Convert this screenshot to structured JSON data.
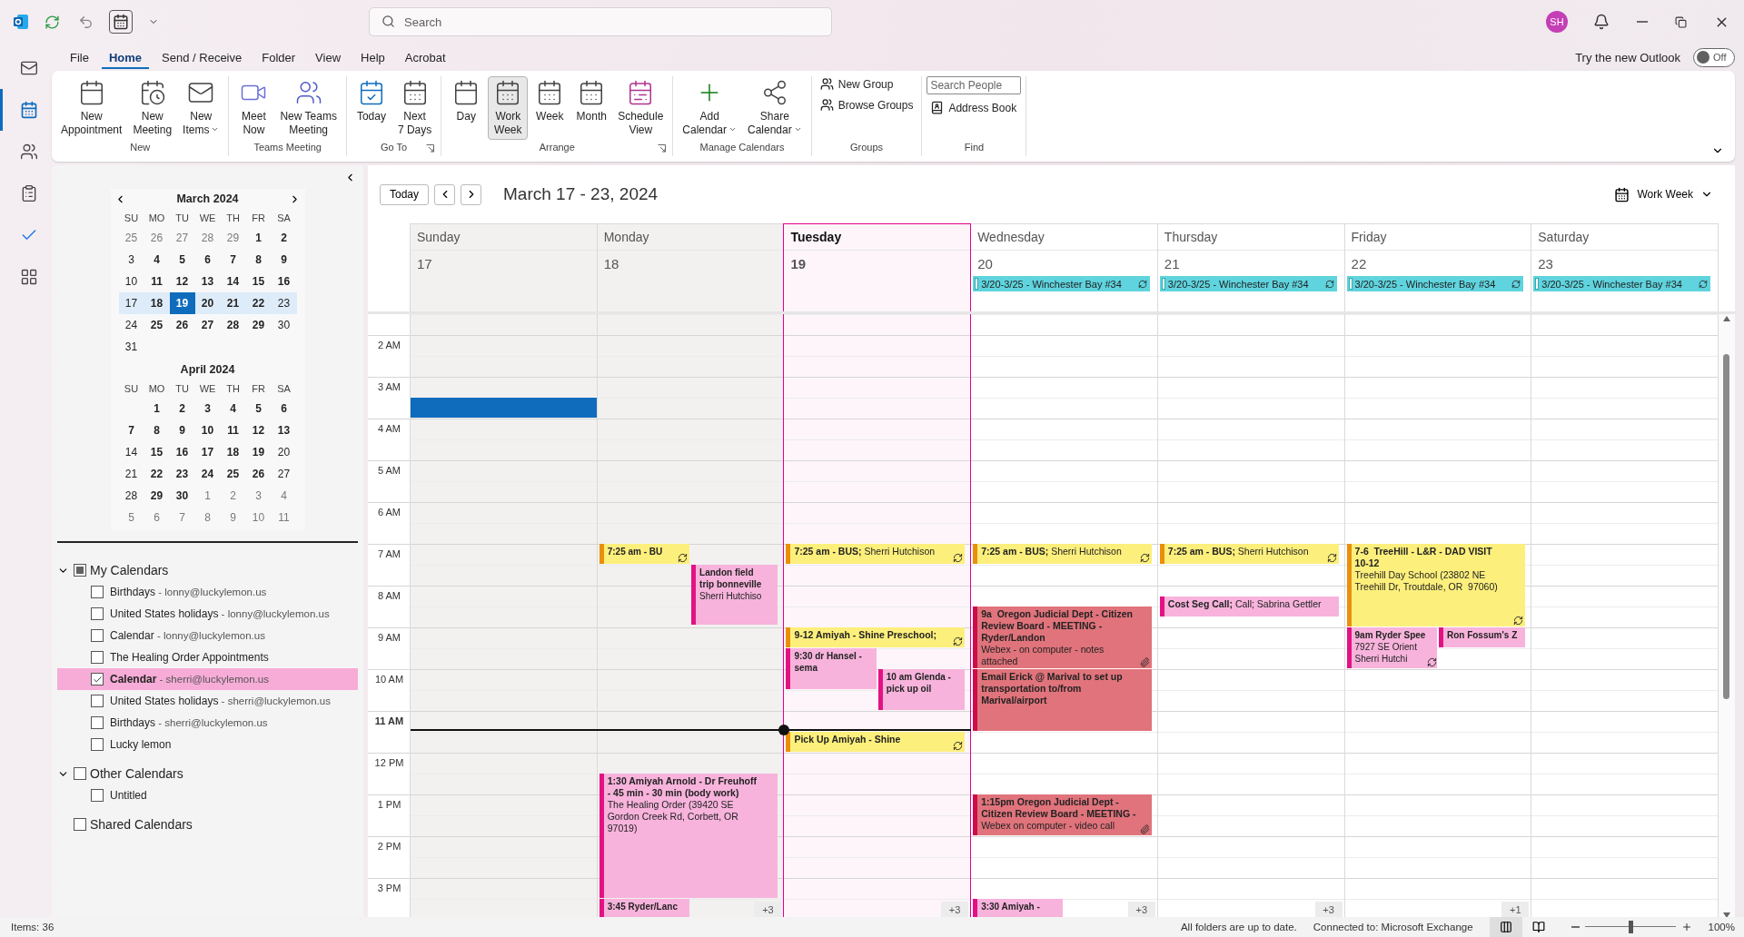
{
  "title_bar": {
    "search_placeholder": "Search",
    "avatar": "SH"
  },
  "nav_rail": [
    {
      "selected": false
    },
    {
      "selected": true
    },
    {
      "selected": false
    },
    {
      "selected": false
    },
    {
      "selected": false
    },
    {
      "selected": false
    }
  ],
  "menu_tabs": [
    {
      "label": "File",
      "selected": false
    },
    {
      "label": "Home",
      "selected": true
    },
    {
      "label": "Send / Receive",
      "selected": false
    },
    {
      "label": "Folder",
      "selected": false
    },
    {
      "label": "View",
      "selected": false
    },
    {
      "label": "Help",
      "selected": false
    },
    {
      "label": "Acrobat",
      "selected": false
    }
  ],
  "new_outlook": {
    "label": "Try the new Outlook",
    "toggle": "Off",
    "on": false
  },
  "ribbon": [
    {
      "label": "New",
      "kind": "large",
      "buttons": [
        {
          "label": "New\nAppointment",
          "dropdown": false
        },
        {
          "label": "New\nMeeting",
          "dropdown": false
        },
        {
          "label": "New\nItems",
          "dropdown": true
        }
      ]
    },
    {
      "label": "Teams Meeting",
      "kind": "large",
      "buttons": [
        {
          "label": "Meet\nNow",
          "dropdown": false
        },
        {
          "label": "New Teams\nMeeting",
          "dropdown": false
        }
      ]
    },
    {
      "label": "Go To",
      "kind": "large",
      "launcher": true,
      "buttons": [
        {
          "label": "Today",
          "dropdown": false
        },
        {
          "label": "Next\n7 Days",
          "dropdown": false
        }
      ]
    },
    {
      "label": "Arrange",
      "kind": "large",
      "launcher": true,
      "buttons": [
        {
          "label": "Day",
          "dropdown": false,
          "selected": false
        },
        {
          "label": "Work\nWeek",
          "dropdown": false,
          "selected": true
        },
        {
          "label": "Week",
          "dropdown": false,
          "selected": false
        },
        {
          "label": "Month",
          "dropdown": false,
          "selected": false
        },
        {
          "label": "Schedule\nView",
          "dropdown": false,
          "selected": false
        }
      ]
    },
    {
      "label": "Manage Calendars",
      "kind": "large",
      "buttons": [
        {
          "label": "Add\nCalendar",
          "dropdown": true
        },
        {
          "label": "Share\nCalendar",
          "dropdown": true
        }
      ]
    },
    {
      "label": "Groups",
      "kind": "small",
      "buttons": [
        {
          "label": "New Group"
        },
        {
          "label": "Browse Groups"
        }
      ]
    },
    {
      "label": "Find",
      "kind": "find",
      "search_placeholder": "Search People",
      "buttons": [
        {
          "label": "Address Book"
        }
      ]
    }
  ],
  "mini_calendars": [
    {
      "title": "March 2024",
      "weekdays": [
        "SU",
        "MO",
        "TU",
        "WE",
        "TH",
        "FR",
        "SA"
      ],
      "weeks": [
        {
          "highlighted": false,
          "days": [
            {
              "text": "25",
              "bold": false,
              "muted": true,
              "selected": false
            },
            {
              "text": "26",
              "bold": false,
              "muted": true,
              "selected": false
            },
            {
              "text": "27",
              "bold": false,
              "muted": true,
              "selected": false
            },
            {
              "text": "28",
              "bold": false,
              "muted": true,
              "selected": false
            },
            {
              "text": "29",
              "bold": false,
              "muted": true,
              "selected": false
            },
            {
              "text": "1",
              "bold": true,
              "muted": false,
              "selected": false
            },
            {
              "text": "2",
              "bold": true,
              "muted": false,
              "selected": false
            }
          ]
        },
        {
          "highlighted": false,
          "days": [
            {
              "text": "3",
              "bold": false,
              "muted": false,
              "selected": false
            },
            {
              "text": "4",
              "bold": true,
              "muted": false,
              "selected": false
            },
            {
              "text": "5",
              "bold": true,
              "muted": false,
              "selected": false
            },
            {
              "text": "6",
              "bold": true,
              "muted": false,
              "selected": false
            },
            {
              "text": "7",
              "bold": true,
              "muted": false,
              "selected": false
            },
            {
              "text": "8",
              "bold": true,
              "muted": false,
              "selected": false
            },
            {
              "text": "9",
              "bold": true,
              "muted": false,
              "selected": false
            }
          ]
        },
        {
          "highlighted": false,
          "days": [
            {
              "text": "10",
              "bold": false,
              "muted": false,
              "selected": false
            },
            {
              "text": "11",
              "bold": true,
              "muted": false,
              "selected": false
            },
            {
              "text": "12",
              "bold": true,
              "muted": false,
              "selected": false
            },
            {
              "text": "13",
              "bold": true,
              "muted": false,
              "selected": false
            },
            {
              "text": "14",
              "bold": true,
              "muted": false,
              "selected": false
            },
            {
              "text": "15",
              "bold": true,
              "muted": false,
              "selected": false
            },
            {
              "text": "16",
              "bold": true,
              "muted": false,
              "selected": false
            }
          ]
        },
        {
          "highlighted": true,
          "days": [
            {
              "text": "17",
              "bold": false,
              "muted": false,
              "selected": false
            },
            {
              "text": "18",
              "bold": true,
              "muted": false,
              "selected": false
            },
            {
              "text": "19",
              "bold": true,
              "muted": false,
              "selected": true
            },
            {
              "text": "20",
              "bold": true,
              "muted": false,
              "selected": false
            },
            {
              "text": "21",
              "bold": true,
              "muted": false,
              "selected": false
            },
            {
              "text": "22",
              "bold": true,
              "muted": false,
              "selected": false
            },
            {
              "text": "23",
              "bold": false,
              "muted": false,
              "selected": false
            }
          ]
        },
        {
          "highlighted": false,
          "days": [
            {
              "text": "24",
              "bold": false,
              "muted": false,
              "selected": false
            },
            {
              "text": "25",
              "bold": true,
              "muted": false,
              "selected": false
            },
            {
              "text": "26",
              "bold": true,
              "muted": false,
              "selected": false
            },
            {
              "text": "27",
              "bold": true,
              "muted": false,
              "selected": false
            },
            {
              "text": "28",
              "bold": true,
              "muted": false,
              "selected": false
            },
            {
              "text": "29",
              "bold": true,
              "muted": false,
              "selected": false
            },
            {
              "text": "30",
              "bold": false,
              "muted": false,
              "selected": false
            }
          ]
        },
        {
          "highlighted": false,
          "days": [
            {
              "text": "31",
              "bold": false,
              "muted": false,
              "selected": false
            }
          ]
        }
      ]
    },
    {
      "title": "April 2024",
      "weekdays": [
        "SU",
        "MO",
        "TU",
        "WE",
        "TH",
        "FR",
        "SA"
      ],
      "weeks": [
        {
          "highlighted": false,
          "days": [
            {
              "text": "1",
              "bold": true,
              "muted": false,
              "selected": false
            },
            {
              "text": "2",
              "bold": true,
              "muted": false,
              "selected": false
            },
            {
              "text": "3",
              "bold": true,
              "muted": false,
              "selected": false
            },
            {
              "text": "4",
              "bold": true,
              "muted": false,
              "selected": false
            },
            {
              "text": "5",
              "bold": true,
              "muted": false,
              "selected": false
            },
            {
              "text": "6",
              "bold": true,
              "muted": false,
              "selected": false
            }
          ]
        },
        {
          "highlighted": false,
          "days": [
            {
              "text": "7",
              "bold": true,
              "muted": false,
              "selected": false
            },
            {
              "text": "8",
              "bold": true,
              "muted": false,
              "selected": false
            },
            {
              "text": "9",
              "bold": true,
              "muted": false,
              "selected": false
            },
            {
              "text": "10",
              "bold": true,
              "muted": false,
              "selected": false
            },
            {
              "text": "11",
              "bold": true,
              "muted": false,
              "selected": false
            },
            {
              "text": "12",
              "bold": true,
              "muted": false,
              "selected": false
            },
            {
              "text": "13",
              "bold": true,
              "muted": false,
              "selected": false
            }
          ]
        },
        {
          "highlighted": false,
          "days": [
            {
              "text": "14",
              "bold": false,
              "muted": false,
              "selected": false
            },
            {
              "text": "15",
              "bold": true,
              "muted": false,
              "selected": false
            },
            {
              "text": "16",
              "bold": true,
              "muted": false,
              "selected": false
            },
            {
              "text": "17",
              "bold": true,
              "muted": false,
              "selected": false
            },
            {
              "text": "18",
              "bold": true,
              "muted": false,
              "selected": false
            },
            {
              "text": "19",
              "bold": true,
              "muted": false,
              "selected": false
            },
            {
              "text": "20",
              "bold": false,
              "muted": false,
              "selected": false
            }
          ]
        },
        {
          "highlighted": false,
          "days": [
            {
              "text": "21",
              "bold": false,
              "muted": false,
              "selected": false
            },
            {
              "text": "22",
              "bold": true,
              "muted": false,
              "selected": false
            },
            {
              "text": "23",
              "bold": true,
              "muted": false,
              "selected": false
            },
            {
              "text": "24",
              "bold": true,
              "muted": false,
              "selected": false
            },
            {
              "text": "25",
              "bold": true,
              "muted": false,
              "selected": false
            },
            {
              "text": "26",
              "bold": true,
              "muted": false,
              "selected": false
            },
            {
              "text": "27",
              "bold": false,
              "muted": false,
              "selected": false
            }
          ]
        },
        {
          "highlighted": false,
          "days": [
            {
              "text": "28",
              "bold": false,
              "muted": false,
              "selected": false
            },
            {
              "text": "29",
              "bold": true,
              "muted": false,
              "selected": false
            },
            {
              "text": "30",
              "bold": true,
              "muted": false,
              "selected": false
            },
            {
              "text": "1",
              "bold": false,
              "muted": true,
              "selected": false
            },
            {
              "text": "2",
              "bold": false,
              "muted": true,
              "selected": false
            },
            {
              "text": "3",
              "bold": false,
              "muted": true,
              "selected": false
            },
            {
              "text": "4",
              "bold": false,
              "muted": true,
              "selected": false
            }
          ]
        },
        {
          "highlighted": false,
          "days": [
            {
              "text": "5",
              "bold": false,
              "muted": true,
              "selected": false
            },
            {
              "text": "6",
              "bold": false,
              "muted": true,
              "selected": false
            },
            {
              "text": "7",
              "bold": false,
              "muted": true,
              "selected": false
            },
            {
              "text": "8",
              "bold": false,
              "muted": true,
              "selected": false
            },
            {
              "text": "9",
              "bold": false,
              "muted": true,
              "selected": false
            },
            {
              "text": "10",
              "bold": false,
              "muted": true,
              "selected": false
            },
            {
              "text": "11",
              "bold": false,
              "muted": true,
              "selected": false
            }
          ]
        }
      ]
    }
  ],
  "calendar_groups": [
    {
      "label": "My Calendars",
      "expanded": true,
      "checked": false,
      "partial": true,
      "items": [
        {
          "name": "Birthdays",
          "account": "- lonny@luckylemon.us",
          "checked": false,
          "selected": false
        },
        {
          "name": "United States holidays",
          "account": "- lonny@luckylemon.us",
          "checked": false,
          "selected": false
        },
        {
          "name": "Calendar",
          "account": "- lonny@luckylemon.us",
          "checked": false,
          "selected": false
        },
        {
          "name": "The Healing Order Appointments",
          "checked": false,
          "selected": false
        },
        {
          "name": "Calendar",
          "account": "- sherri@luckylemon.us",
          "checked": true,
          "selected": true
        },
        {
          "name": "United States holidays",
          "account": "- sherri@luckylemon.us",
          "checked": false,
          "selected": false
        },
        {
          "name": "Birthdays",
          "account": "- sherri@luckylemon.us",
          "checked": false,
          "selected": false
        },
        {
          "name": "Lucky lemon",
          "checked": false,
          "selected": false
        }
      ]
    },
    {
      "label": "Other Calendars",
      "expanded": true,
      "checked": false,
      "partial": false,
      "items": [
        {
          "name": "Untitled",
          "checked": false,
          "selected": false
        }
      ]
    },
    {
      "label": "Shared Calendars",
      "checked": false,
      "partial": false
    }
  ],
  "calendar": {
    "today_button": "Today",
    "title": "March 17 - 23, 2024",
    "view": "Work Week",
    "hours": [
      {
        "label": "2 AM",
        "current": false
      },
      {
        "label": "3 AM",
        "current": false
      },
      {
        "label": "4 AM",
        "current": false
      },
      {
        "label": "5 AM",
        "current": false
      },
      {
        "label": "6 AM",
        "current": false
      },
      {
        "label": "7 AM",
        "current": false
      },
      {
        "label": "8 AM",
        "current": false
      },
      {
        "label": "9 AM",
        "current": false
      },
      {
        "label": "10 AM",
        "current": false
      },
      {
        "label": "11 AM",
        "current": true
      },
      {
        "label": "12 PM",
        "current": false
      },
      {
        "label": "1 PM",
        "current": false
      },
      {
        "label": "2 PM",
        "current": false
      },
      {
        "label": "3 PM",
        "current": false
      }
    ],
    "days": [
      {
        "name": "Sunday",
        "date": "17",
        "selected": false,
        "past": true,
        "events": [
          {
            "kind": "selection"
          }
        ]
      },
      {
        "name": "Monday",
        "date": "18",
        "selected": false,
        "past": true,
        "more": "+3",
        "events": [
          {
            "kind": "event",
            "color": "#fdef7c",
            "text": "**7:25 am - BU**",
            "recurring": true
          },
          {
            "kind": "event",
            "color": "#f7b3dc",
            "text": "**Landon field\ntrip bonneville**\nSherri Hutchiso"
          },
          {
            "kind": "event",
            "color": "#f7b3dc",
            "text": "**1:30 Amiyah Arnold - Dr Freuhoff\n- 45 min - 30 min (body work)**\nThe Healing Order (39420 SE\nGordon Creek Rd, Corbett, OR\n97019)"
          },
          {
            "kind": "event",
            "color": "#f7b3dc",
            "text": "**3:45 Ryder/Lanc**"
          }
        ]
      },
      {
        "name": "Tuesday",
        "date": "19",
        "selected": true,
        "past": false,
        "more": "+3",
        "events": [
          {
            "kind": "event",
            "color": "#fdef7c",
            "text": "**7:25 am - BUS;** Sherri Hutchison",
            "recurring": true
          },
          {
            "kind": "event",
            "color": "#fdef7c",
            "text": "**9-12 Amiyah - Shine Preschool;**",
            "recurring": true
          },
          {
            "kind": "event",
            "color": "#f7b3dc",
            "text": "**9:30 dr Hansel -\nsema**"
          },
          {
            "kind": "event",
            "color": "#f7b3dc",
            "text": "**10 am Glenda -\npick up oil**"
          },
          {
            "kind": "event",
            "color": "#fdef7c",
            "text": "**Pick Up Amiyah - Shine**",
            "recurring": true
          }
        ]
      },
      {
        "name": "Wednesday",
        "date": "20",
        "selected": false,
        "past": false,
        "more": "+3",
        "all_day": [
          {
            "text": "3/20-3/25 - Winchester Bay #34",
            "color": "#5fd4de",
            "recurring": true
          }
        ],
        "events": [
          {
            "kind": "event",
            "color": "#fdef7c",
            "text": "**7:25 am - BUS;** Sherri Hutchison",
            "recurring": true
          },
          {
            "kind": "event",
            "color": "#e0737b",
            "text": "**9a  Oregon Judicial Dept - Citizen\nReview Board - MEETING -\nRyder/Landon**\nWebex - on computer - notes\nattached",
            "attachment": true
          },
          {
            "kind": "event",
            "color": "#e0737b",
            "text": "**Email Erick @ Marival to set up\ntransportation to/from\nMarival/airport**"
          },
          {
            "kind": "event",
            "color": "#e0737b",
            "text": "**1:15pm Oregon Judicial Dept -\nCitizen Review Board - MEETING -**\nWebex on computer - video call",
            "attachment": true
          },
          {
            "kind": "event",
            "color": "#f7b3dc",
            "text": "**3:30 Amiyah -**"
          }
        ]
      },
      {
        "name": "Thursday",
        "date": "21",
        "selected": false,
        "past": false,
        "more": "+3",
        "all_day": [
          {
            "text": "3/20-3/25 - Winchester Bay #34",
            "color": "#5fd4de",
            "recurring": true
          }
        ],
        "events": [
          {
            "kind": "event",
            "color": "#fdef7c",
            "text": "**7:25 am - BUS;** Sherri Hutchison",
            "recurring": true
          },
          {
            "kind": "event",
            "color": "#f7b3dc",
            "text": "**Cost Seg Call;** Call; Sabrina Gettler"
          }
        ]
      },
      {
        "name": "Friday",
        "date": "22",
        "selected": false,
        "past": false,
        "more": "+1",
        "all_day": [
          {
            "text": "3/20-3/25 - Winchester Bay #34",
            "color": "#5fd4de",
            "recurring": true
          }
        ],
        "events": [
          {
            "kind": "event",
            "color": "#fdef7c",
            "text": "**7-6  TreeHill - L&R - DAD VISIT\n10-12**\nTreehill Day School (23802 NE\nTreehill Dr, Troutdale, OR  97060)",
            "recurring": true
          },
          {
            "kind": "event",
            "color": "#f7b3dc",
            "text": "**9am Ryder Spee**\n7927 SE Orient\nSherri Hutchi",
            "recurring": true
          },
          {
            "kind": "event",
            "color": "#f7b3dc",
            "text": "**Ron Fossum's Z**"
          }
        ]
      },
      {
        "name": "Saturday",
        "date": "23",
        "selected": false,
        "past": false,
        "all_day": [
          {
            "text": "3/20-3/25 - Winchester Bay #34",
            "color": "#5fd4de",
            "recurring": true
          }
        ]
      }
    ]
  },
  "status_bar": {
    "items": "Items: 36",
    "sync": "All folders are up to date.",
    "connection": "Connected to: Microsoft Exchange",
    "views": [
      {
        "selected": true
      },
      {
        "selected": false
      }
    ],
    "zoom": {
      "level": 0.5,
      "label": "100%"
    }
  }
}
